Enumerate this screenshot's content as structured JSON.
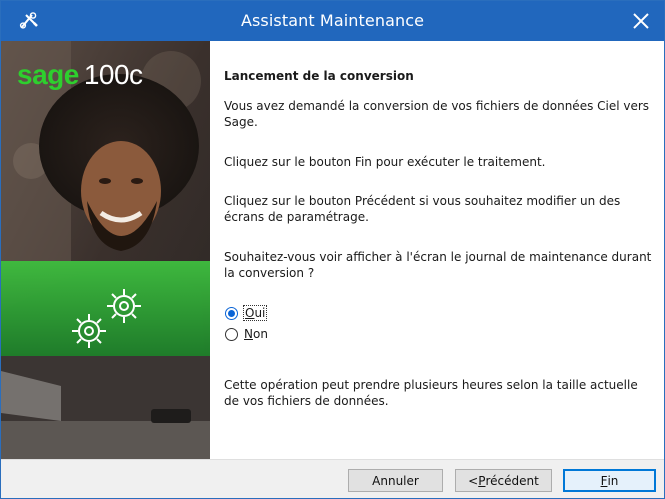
{
  "window": {
    "title": "Assistant Maintenance"
  },
  "branding": {
    "part1": "sage",
    "part2": "100c"
  },
  "content": {
    "heading": "Lancement de la conversion",
    "p1": "Vous avez demandé la conversion de vos fichiers de données Ciel vers Sage.",
    "p2": "Cliquez sur le bouton Fin pour exécuter le traitement.",
    "p3": "Cliquez sur le bouton Précédent si vous souhaitez modifier un des écrans de paramétrage.",
    "p4": "Souhaitez-vous voir afficher à l'écran le journal de maintenance durant la conversion ?",
    "options": [
      {
        "mnemonic": "O",
        "rest": "ui",
        "selected": true
      },
      {
        "mnemonic": "N",
        "rest": "on",
        "selected": false
      }
    ],
    "p5": "Cette opération peut prendre plusieurs heures selon la taille actuelle de vos fichiers de données."
  },
  "buttons": {
    "cancel": "Annuler",
    "back_prefix": "< ",
    "back_mnemonic": "P",
    "back_rest": "récédent",
    "finish_mnemonic": "F",
    "finish_rest": "in"
  },
  "colors": {
    "titlebar": "#2167bd",
    "accent_green": "#2ecf2e",
    "primary_button_border": "#0078d7"
  },
  "icons": [
    "app-icon",
    "close-icon",
    "gears-icon",
    "radio-selected-icon",
    "radio-unselected-icon"
  ]
}
